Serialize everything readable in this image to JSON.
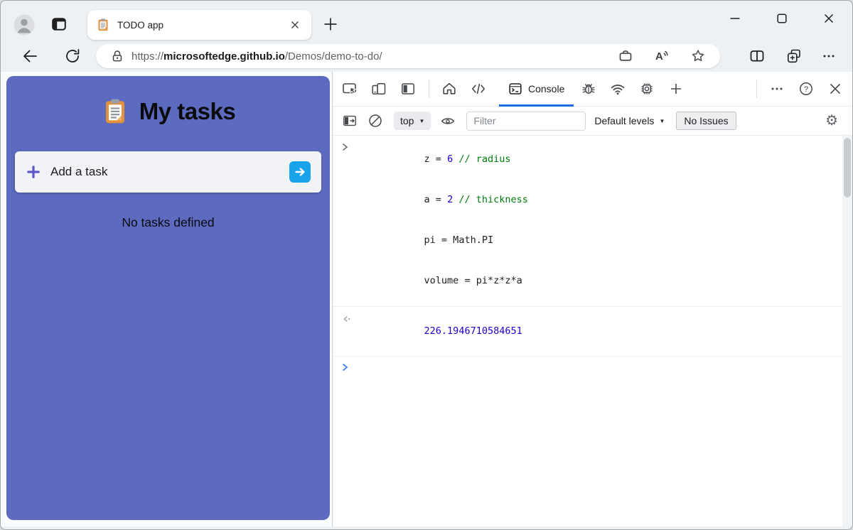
{
  "browser": {
    "tab": {
      "title": "TODO app"
    },
    "address": {
      "scheme": "https://",
      "host": "microsoftedge.github.io",
      "path": "/Demos/demo-to-do/"
    }
  },
  "app": {
    "title": "My tasks",
    "add_task_label": "Add a task",
    "empty_message": "No tasks defined"
  },
  "devtools": {
    "console_tab_label": "Console",
    "context_selector": "top",
    "filter_placeholder": "Filter",
    "levels_label": "Default levels",
    "no_issues_label": "No Issues",
    "console": {
      "lines": [
        {
          "pre": "z = ",
          "num": "6",
          "comment": "// radius"
        },
        {
          "pre": "a = ",
          "num": "2",
          "comment": "// thickness"
        },
        {
          "pre": "pi = Math.PI",
          "num": "",
          "comment": ""
        },
        {
          "pre": "volume = pi*z*z*a",
          "num": "",
          "comment": ""
        }
      ],
      "result": "226.1946710584651"
    }
  },
  "icons": {
    "gear": "⚙",
    "caret_down": "▼"
  },
  "colors": {
    "app_accent": "#5c6bc0",
    "arrow_button": "#18a3ea",
    "tab_underline": "#1a6ee0",
    "number_token": "#1c00cf",
    "comment_token": "#007d0c"
  }
}
